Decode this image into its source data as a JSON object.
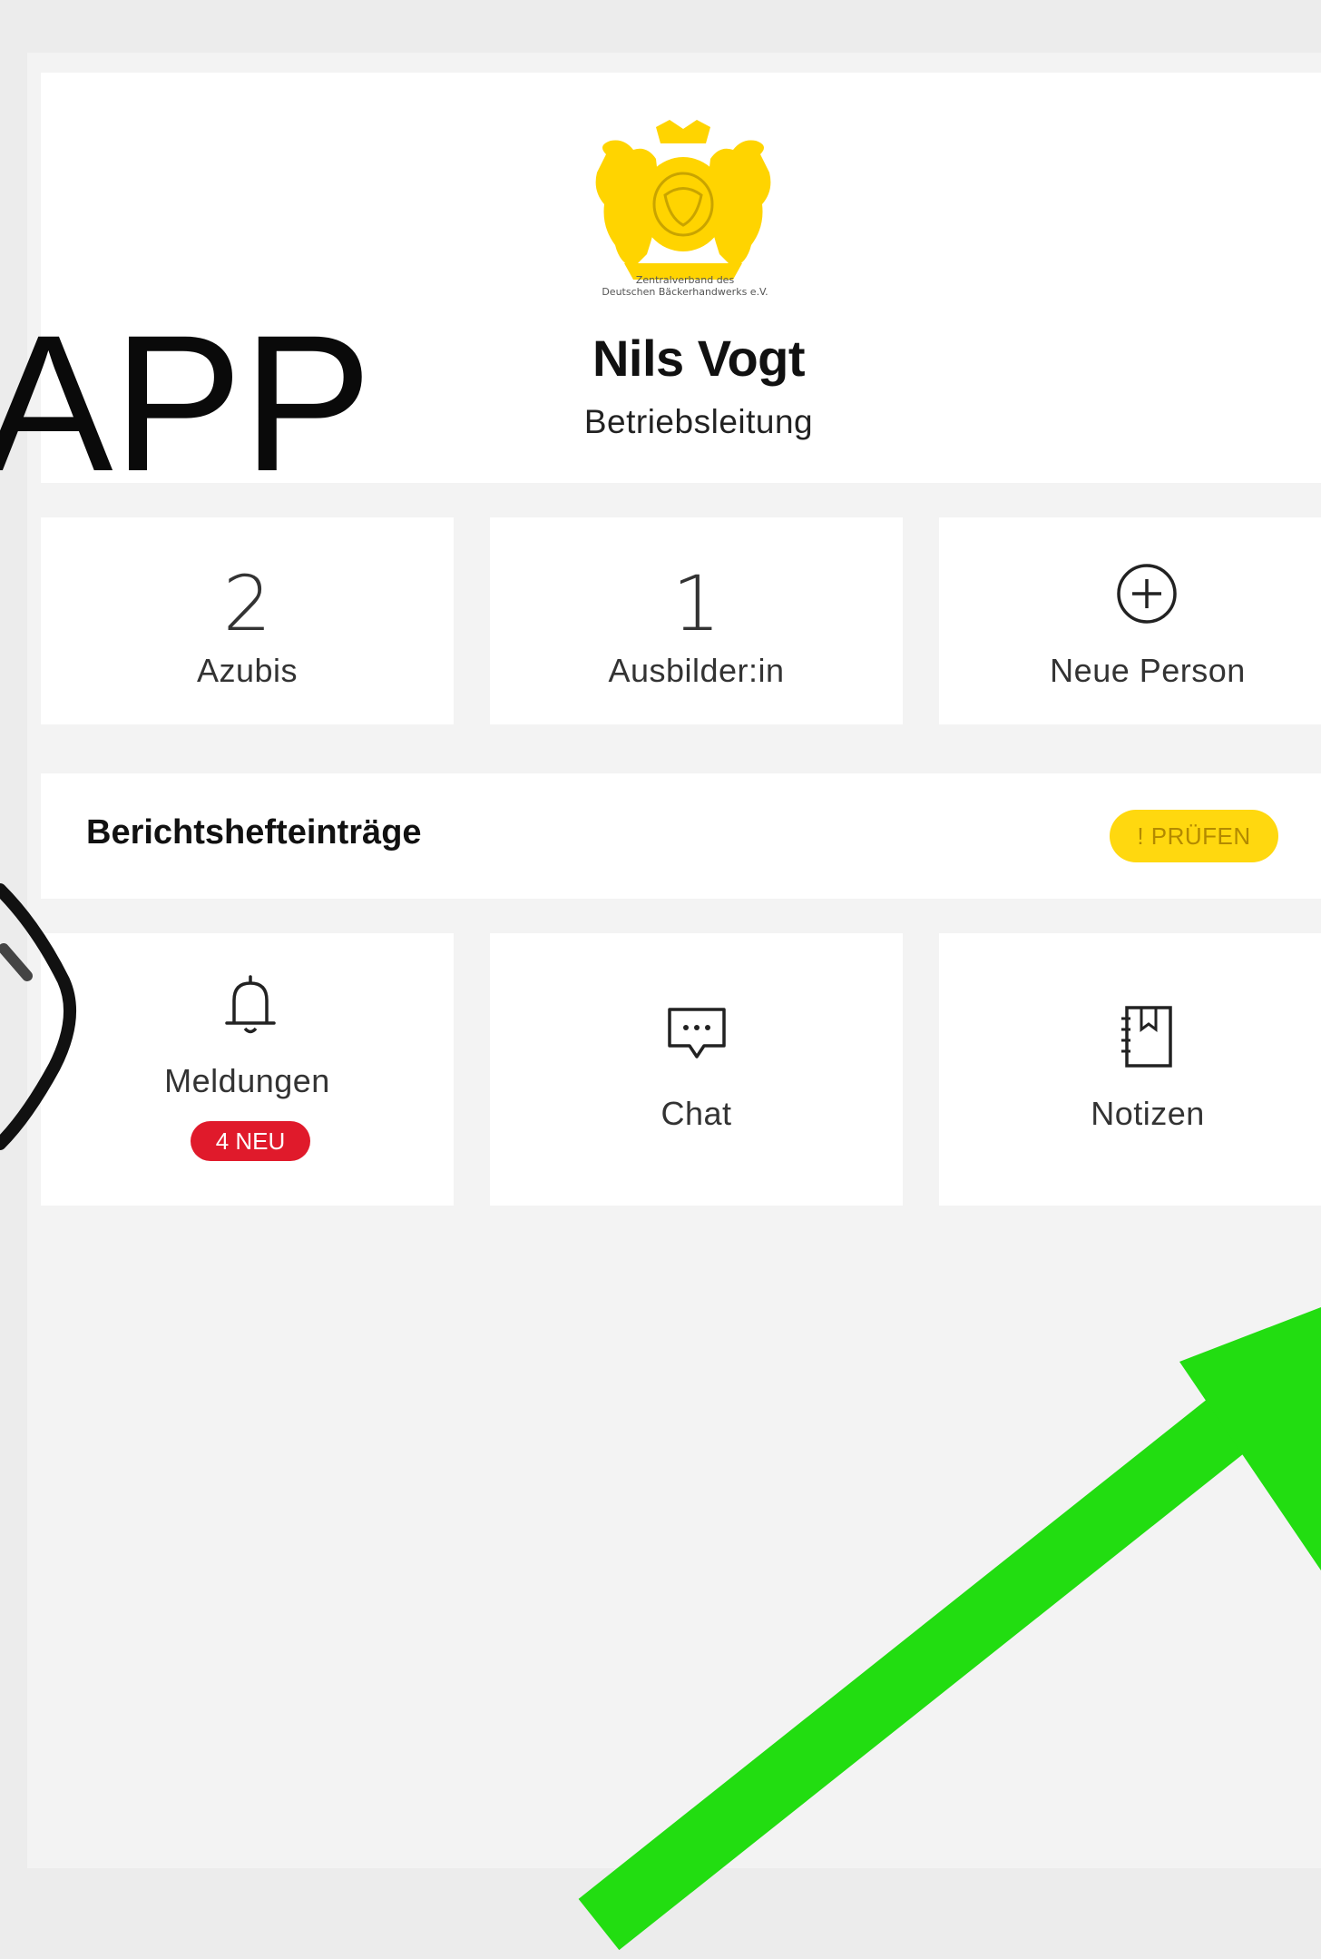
{
  "overlay": {
    "title": "-APP"
  },
  "header": {
    "logo_caption_line1": "Zentralverband des",
    "logo_caption_line2": "Deutschen Bäckerhandwerks e.V.",
    "user_name": "Nils Vogt",
    "user_role": "Betriebsleitung"
  },
  "stats": {
    "azubis_count": "2",
    "azubis_label": "Azubis",
    "ausbilder_count": "1",
    "ausbilder_label": "Ausbilder:in",
    "new_person_label": "Neue Person"
  },
  "reports": {
    "title": "Berichtshefteinträge",
    "badge": "! PRÜFEN"
  },
  "features": {
    "notifications_label": "Meldungen",
    "notifications_badge": "4 NEU",
    "chat_label": "Chat",
    "notes_label": "Notizen"
  },
  "colors": {
    "accent_yellow": "#ffd80f",
    "badge_red": "#e01a2b",
    "arrow_green": "#22dd11"
  },
  "icons": [
    "plus-circle-icon",
    "chevron-right-icon",
    "bell-icon",
    "chat-bubble-icon",
    "notebook-icon",
    "logo-emblem"
  ]
}
